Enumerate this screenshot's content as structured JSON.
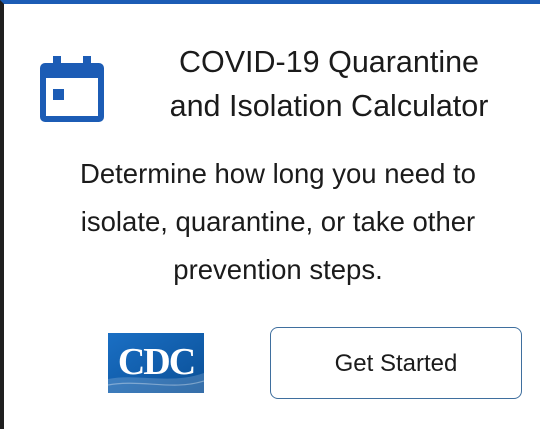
{
  "card": {
    "icon": "calendar-icon",
    "title_line_1": "COVID-19 Quarantine",
    "title_line_2": "and Isolation Calculator",
    "description_line_1": "Determine how long you need to",
    "description_line_2": "isolate, quarantine, or take other",
    "description_line_3": "prevention steps.",
    "logo_text": "CDC",
    "button_label": "Get Started"
  },
  "colors": {
    "accent_blue": "#1c5cb5",
    "logo_blue": "#0a5cab",
    "button_border": "#3f6f9e",
    "text": "#1b1b1b"
  }
}
